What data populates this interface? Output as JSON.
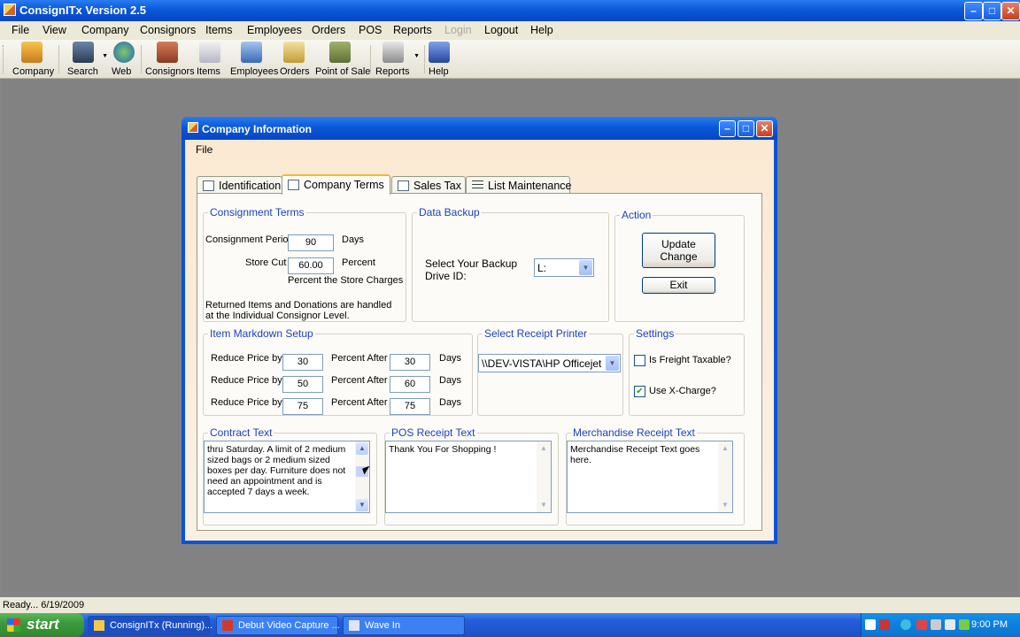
{
  "window": {
    "title": "ConsignITx Version 2.5",
    "min": "–",
    "max": "□",
    "close": "✕"
  },
  "menu": [
    "File",
    "View",
    "Company",
    "Consignors",
    "Items",
    "Employees",
    "Orders",
    "POS",
    "Reports",
    "Login",
    "Logout",
    "Help"
  ],
  "toolbar": [
    "Company",
    "Search",
    "Web",
    "Consignors",
    "Items",
    "Employees",
    "Orders",
    "Point of Sale",
    "Reports",
    "Help"
  ],
  "toolbar_icons": [
    "house-icon",
    "binoculars-icon",
    "globe-icon",
    "people-icon",
    "items-icon",
    "employees-icon",
    "clipboard-icon",
    "cash-register-icon",
    "printer-icon",
    "book-icon"
  ],
  "dialog": {
    "title": "Company Information",
    "menu_file": "File",
    "tabs": [
      "Identification",
      "Company Terms",
      "Sales Tax",
      "List Maintenance"
    ],
    "consignment_terms": {
      "legend": "Consignment Terms",
      "period_label": "Consignment Period",
      "period_value": "90",
      "days": "Days",
      "store_cut_label": "Store Cut",
      "store_cut_value": "60.00",
      "percent": "Percent",
      "percent_note": "Percent the Store Charges",
      "returned_note": "Returned Items and Donations are handled at the Individual Consignor Level."
    },
    "data_backup": {
      "legend": "Data Backup",
      "label": "Select Your Backup Drive ID:",
      "value": "L:"
    },
    "action": {
      "legend": "Action",
      "update": "Update Change",
      "exit": "Exit"
    },
    "markdown": {
      "legend": "Item Markdown Setup",
      "reduce_label": "Reduce Price by",
      "after_label": "Percent After",
      "days": "Days",
      "rows": [
        {
          "percent": "30",
          "after": "30"
        },
        {
          "percent": "50",
          "after": "60"
        },
        {
          "percent": "75",
          "after": "75"
        }
      ]
    },
    "receipt_printer": {
      "legend": "Select Receipt Printer",
      "value": "\\\\DEV-VISTA\\HP Officejet"
    },
    "settings": {
      "legend": "Settings",
      "freight": "Is Freight Taxable?",
      "freight_checked": false,
      "xcharge": "Use X-Charge?",
      "xcharge_checked": true
    },
    "contract_text": {
      "legend": "Contract Text",
      "value": "thru Saturday. A limit of 2 medium sized bags or 2 medium sized boxes per day. Furniture does not need an appointment and is accepted 7 days a week."
    },
    "pos_receipt": {
      "legend": "POS Receipt Text",
      "value": "Thank You For Shopping !"
    },
    "merch_receipt": {
      "legend": "Merchandise Receipt Text",
      "value": "Merchandise Receipt Text goes here."
    }
  },
  "status": "Ready...    6/19/2009",
  "taskbar": {
    "start": "start",
    "tasks": [
      "ConsignITx (Running)...",
      "Debut Video Capture ...",
      "Wave In"
    ],
    "clock": "9:00 PM"
  },
  "glyphs": {
    "up": "▲",
    "down": "▼",
    "check": "✔"
  }
}
